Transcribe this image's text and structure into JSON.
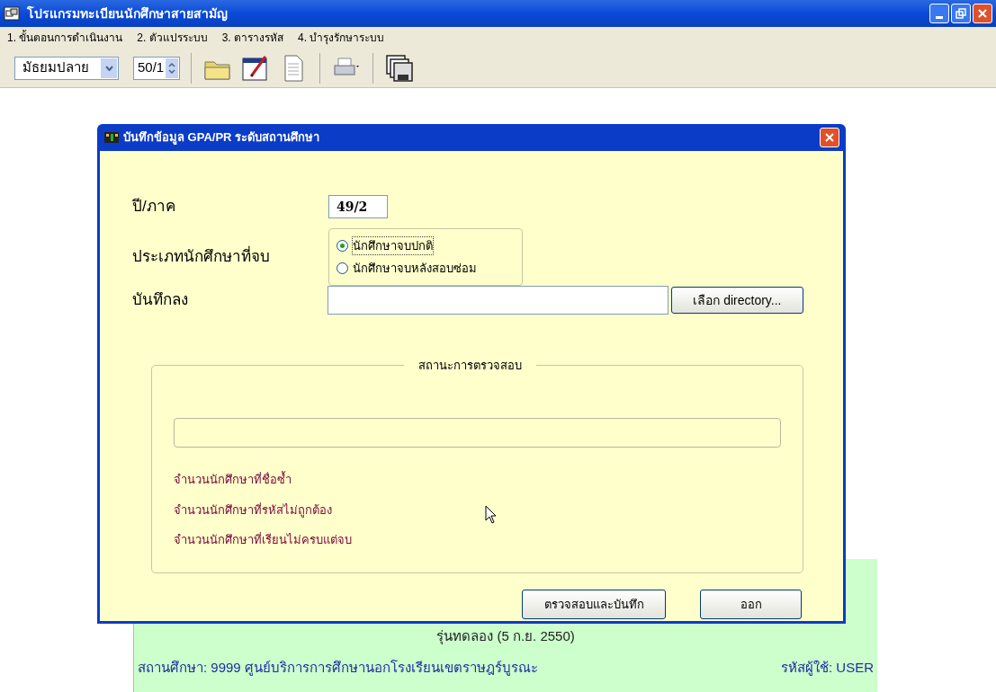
{
  "window": {
    "title": "โปรแกรมทะเบียนนักศึกษาสายสามัญ"
  },
  "menu": [
    "1. ขั้นตอนการดำเนินงาน",
    "2. ตัวแปรระบบ",
    "3. ตารางรหัส",
    "4. บำรุงรักษาระบบ"
  ],
  "toolbar": {
    "level_select": "มัธยมปลาย",
    "class_spinner": "50/1"
  },
  "dialog": {
    "title": "บันทึกข้อมูล GPA/PR ระดับสถานศึกษา",
    "year_term": {
      "label": "ปี/ภาค",
      "value": "49/2"
    },
    "graduate_type": {
      "label": "ประเภทนักศึกษาที่จบ",
      "options": [
        {
          "label": "นักศึกษาจบปกติ",
          "selected": true
        },
        {
          "label": "นักศึกษาจบหลังสอบซ่อม",
          "selected": false
        }
      ]
    },
    "save_to": {
      "label": "บันทึกลง",
      "button": "เลือก directory..."
    },
    "status_group": {
      "title": "สถานะการตรวจสอบ",
      "counts": [
        "จำนวนนักศึกษาที่ชื่อซ้ำ",
        "จำนวนนักศึกษาที่รหัสไม่ถูกต้อง",
        "จำนวนนักศึกษาที่เรียนไม่ครบแต่จบ"
      ]
    },
    "buttons": [
      "ตรวจสอบและบันทึก",
      "ออก"
    ]
  },
  "background_panel": {
    "version": "รุ่นทดลอง (5 ก.ย. 2550)",
    "institution": "สถานศึกษา: 9999  ศูนย์บริการการศึกษานอกโรงเรียนเขตราษฎร์บูรณะ",
    "user": "รหัสผู้ใช้: USER"
  }
}
